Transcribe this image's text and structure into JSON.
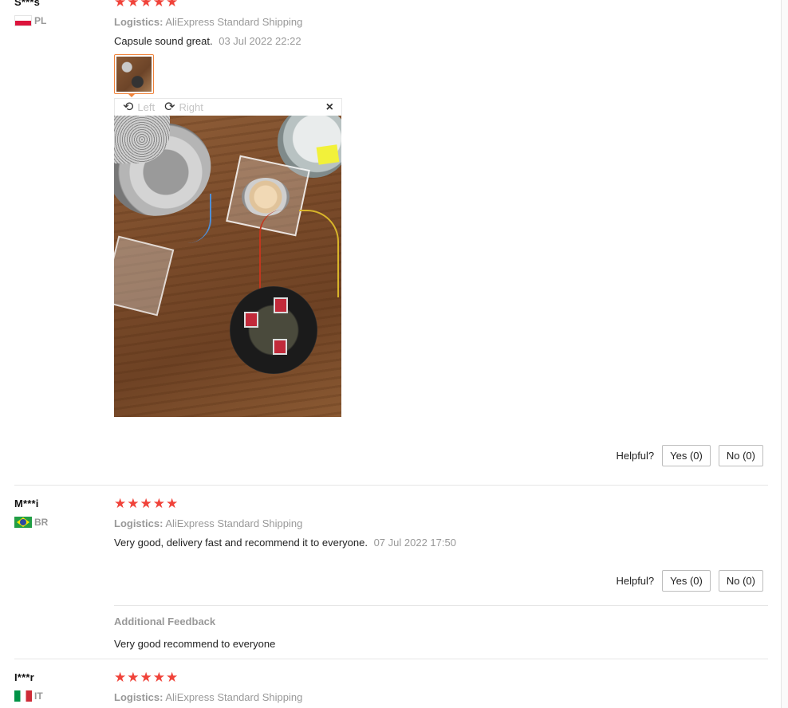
{
  "reviews": [
    {
      "user": "S***s",
      "country": "PL",
      "stars": "★★★★★",
      "logistics_label": "Logistics:",
      "logistics_value": "AliExpress Standard Shipping",
      "text": "Capsule sound great.",
      "date": "03 Jul 2022 22:22",
      "viewer": {
        "rotate_left": "Left",
        "rotate_right": "Right",
        "close": "×"
      },
      "helpful_label": "Helpful?",
      "yes": "Yes (0)",
      "no": "No (0)"
    },
    {
      "user": "M***i",
      "country": "BR",
      "stars": "★★★★★",
      "logistics_label": "Logistics:",
      "logistics_value": "AliExpress Standard Shipping",
      "text": "Very good, delivery fast and recommend it to everyone.",
      "date": "07 Jul 2022 17:50",
      "helpful_label": "Helpful?",
      "yes": "Yes (0)",
      "no": "No (0)",
      "additional_title": "Additional Feedback",
      "additional_text": "Very good recommend to everyone"
    },
    {
      "user": "I***r",
      "country": "IT",
      "stars": "★★★★★",
      "logistics_label": "Logistics:",
      "logistics_value": "AliExpress Standard Shipping"
    }
  ],
  "icons": {
    "rotate_left": "rotate-left-icon",
    "rotate_right": "rotate-right-icon",
    "close": "close-icon",
    "star": "star-icon"
  },
  "colors": {
    "star": "#f0433a",
    "thumb_border": "#f0833a",
    "muted": "#999999"
  }
}
